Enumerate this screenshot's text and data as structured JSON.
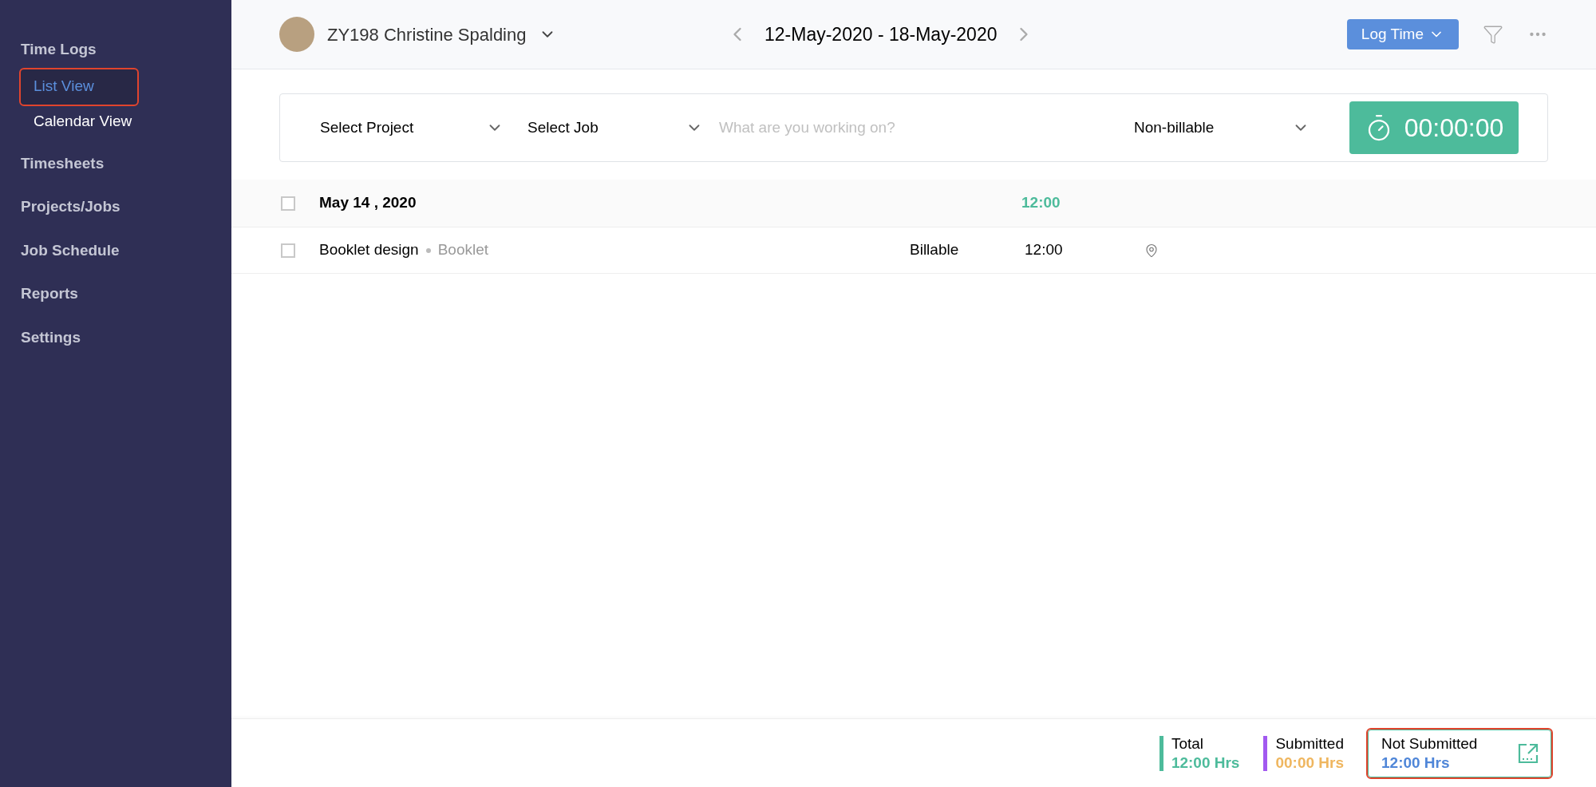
{
  "sidebar": {
    "items": [
      {
        "label": "Time Logs",
        "children": [
          {
            "label": "List View",
            "selected": true,
            "highlighted": true
          },
          {
            "label": "Calendar View",
            "selected": false,
            "highlighted": false
          }
        ]
      },
      {
        "label": "Timesheets"
      },
      {
        "label": "Projects/Jobs"
      },
      {
        "label": "Job Schedule"
      },
      {
        "label": "Reports"
      },
      {
        "label": "Settings"
      }
    ]
  },
  "header": {
    "user": "ZY198 Christine Spalding",
    "date_range": "12-May-2020 - 18-May-2020",
    "log_time_button": "Log Time"
  },
  "timer_bar": {
    "project": "Select Project",
    "job": "Select Job",
    "placeholder": "What are you working on?",
    "billing": "Non-billable",
    "timer": "00:00:00"
  },
  "log_groups": [
    {
      "date": "May 14 , 2020",
      "total": "12:00",
      "checked": false,
      "entries": [
        {
          "title": "Booklet design",
          "project": "Booklet",
          "billing": "Billable",
          "hours": "12:00",
          "checked": false
        }
      ]
    }
  ],
  "summary": [
    {
      "kind": "total",
      "label": "Total",
      "value": "12:00 Hrs",
      "color": "#4dbb9b",
      "highlighted": false
    },
    {
      "kind": "submitted",
      "label": "Submitted",
      "value": "00:00 Hrs",
      "color": "#a259f0",
      "highlighted": false
    },
    {
      "kind": "pending",
      "label": "Not Submitted",
      "value": "12:00 Hrs",
      "highlighted": true
    }
  ]
}
